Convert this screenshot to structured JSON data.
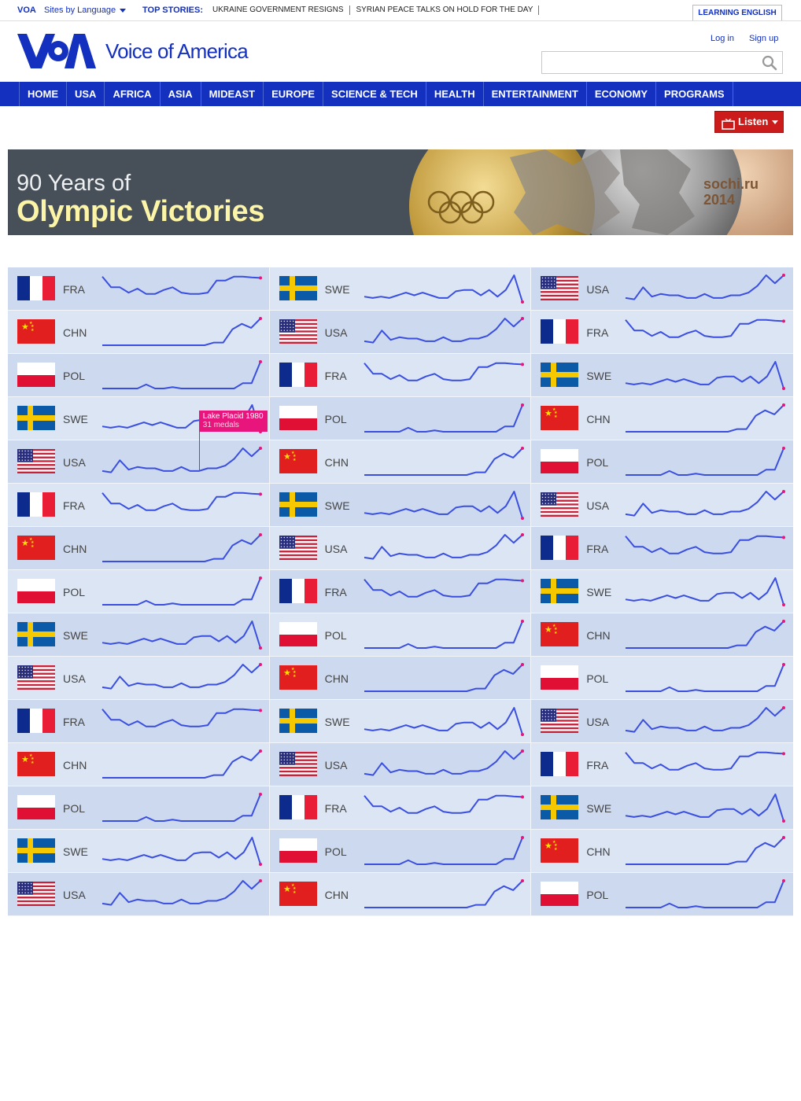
{
  "topbar": {
    "brand": "VOA",
    "sites_label": "Sites by Language",
    "top_stories_label": "TOP STORIES:",
    "stories": [
      "UKRAINE GOVERNMENT RESIGNS",
      "SYRIAN PEACE TALKS ON HOLD FOR THE DAY"
    ],
    "learning_english": "LEARNING ENGLISH"
  },
  "header": {
    "wordmark": "Voice of America",
    "login": "Log in",
    "signup": "Sign up",
    "search_value": ""
  },
  "nav": {
    "items": [
      "HOME",
      "USA",
      "AFRICA",
      "ASIA",
      "MIDEAST",
      "EUROPE",
      "SCIENCE & TECH",
      "HEALTH",
      "ENTERTAINMENT",
      "ECONOMY",
      "PROGRAMS"
    ]
  },
  "listen": {
    "label": "Listen"
  },
  "banner": {
    "line1": "90 Years of",
    "line2": "Olympic Victories",
    "medal_logo_text": "sochi.ru 2014"
  },
  "colors": {
    "brand_blue": "#1330bf",
    "sparkline": "#3a4fe0",
    "highlight": "#e8157c",
    "row_dark": "#cdd9ee",
    "row_light": "#dbe5f4"
  },
  "tooltip": {
    "title": "Lake Placid 1980",
    "value": "31 medals",
    "anchor_country": "USA"
  },
  "series": {
    "FRA": [
      0.95,
      0.55,
      0.55,
      0.35,
      0.5,
      0.3,
      0.3,
      0.45,
      0.55,
      0.35,
      0.3,
      0.3,
      0.35,
      0.8,
      0.8,
      0.95,
      0.95,
      0.92,
      0.9
    ],
    "SWE": [
      0.2,
      0.15,
      0.2,
      0.15,
      0.25,
      0.35,
      0.25,
      0.35,
      0.25,
      0.15,
      0.15,
      0.4,
      0.45,
      0.45,
      0.25,
      0.45,
      0.2,
      0.45,
      1.0,
      0.0
    ],
    "USA": [
      0.15,
      0.1,
      0.55,
      0.2,
      0.3,
      0.25,
      0.25,
      0.15,
      0.15,
      0.3,
      0.15,
      0.15,
      0.25,
      0.25,
      0.35,
      0.6,
      1.0,
      0.7,
      1.0
    ],
    "CHN": [
      0.0,
      0.0,
      0.0,
      0.0,
      0.0,
      0.0,
      0.0,
      0.0,
      0.0,
      0.0,
      0.0,
      0.0,
      0.1,
      0.1,
      0.6,
      0.8,
      0.65,
      1.0
    ],
    "POL": [
      0.0,
      0.0,
      0.0,
      0.0,
      0.0,
      0.15,
      0.0,
      0.0,
      0.05,
      0.0,
      0.0,
      0.0,
      0.0,
      0.0,
      0.0,
      0.0,
      0.2,
      0.2,
      1.0
    ]
  },
  "rows": [
    [
      "FRA",
      "SWE",
      "USA"
    ],
    [
      "CHN",
      "USA",
      "FRA"
    ],
    [
      "POL",
      "FRA",
      "SWE"
    ],
    [
      "SWE",
      "POL",
      "CHN"
    ],
    [
      "USA",
      "CHN",
      "POL"
    ],
    [
      "FRA",
      "SWE",
      "USA"
    ],
    [
      "CHN",
      "USA",
      "FRA"
    ],
    [
      "POL",
      "FRA",
      "SWE"
    ],
    [
      "SWE",
      "POL",
      "CHN"
    ],
    [
      "USA",
      "CHN",
      "POL"
    ],
    [
      "FRA",
      "SWE",
      "USA"
    ],
    [
      "CHN",
      "USA",
      "FRA"
    ],
    [
      "POL",
      "FRA",
      "SWE"
    ],
    [
      "SWE",
      "POL",
      "CHN"
    ],
    [
      "USA",
      "CHN",
      "POL"
    ]
  ]
}
